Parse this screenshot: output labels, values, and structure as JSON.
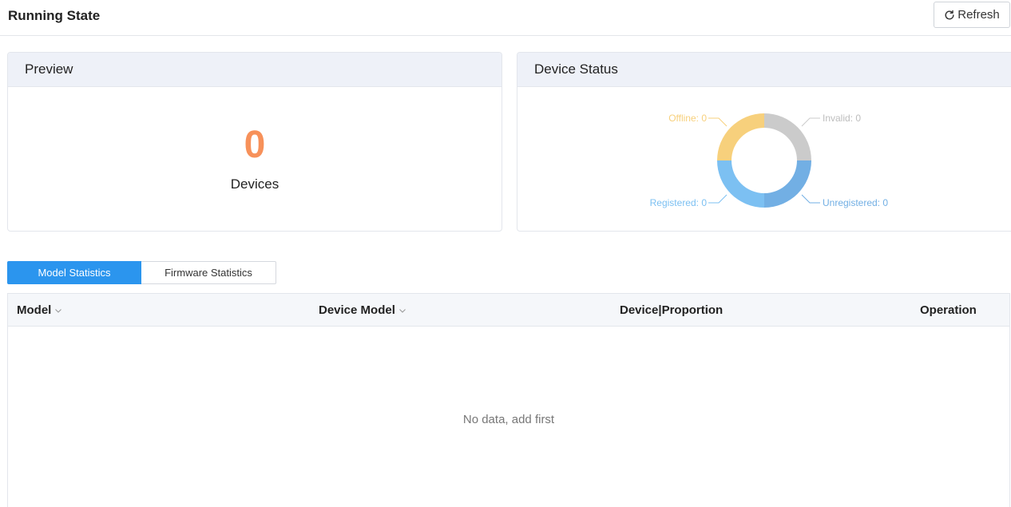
{
  "header": {
    "title": "Running State",
    "refresh_label": "Refresh"
  },
  "preview": {
    "title": "Preview",
    "count": "0",
    "count_label": "Devices"
  },
  "device_status": {
    "title": "Device Status",
    "segments": [
      {
        "key": "invalid",
        "label": "Invalid: 0",
        "color": "#cbcbcb"
      },
      {
        "key": "unregistered",
        "label": "Unregistered: 0",
        "color": "#72afe4"
      },
      {
        "key": "registered",
        "label": "Registered: 0",
        "color": "#7cc0f2"
      },
      {
        "key": "offline",
        "label": "Offline: 0",
        "color": "#f7d07c"
      }
    ]
  },
  "tabs": [
    {
      "label": "Model Statistics",
      "active": true
    },
    {
      "label": "Firmware Statistics",
      "active": false
    }
  ],
  "table": {
    "columns": [
      "Model",
      "Device Model",
      "Device|Proportion",
      "Operation"
    ],
    "empty_text": "No data, add first"
  },
  "colors": {
    "accent": "#2b95ee",
    "count": "#f7915a"
  }
}
